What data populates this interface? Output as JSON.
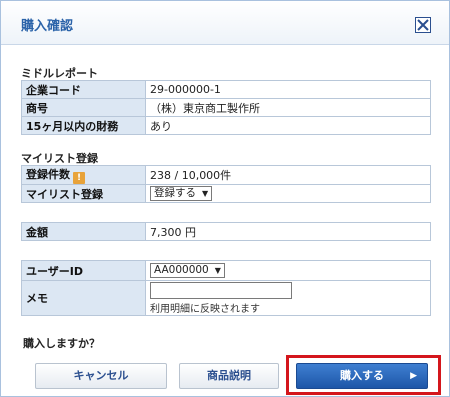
{
  "dialog": {
    "title": "購入確認",
    "close_icon": "close-x-icon"
  },
  "report": {
    "section_title": "ミドルレポート",
    "rows": [
      {
        "label": "企業コード",
        "value": "29-000000-1"
      },
      {
        "label": "商号",
        "value": "（株）東京商工製作所"
      },
      {
        "label": "15ヶ月以内の財務",
        "value": "あり"
      }
    ]
  },
  "mylist": {
    "section_title": "マイリスト登録",
    "count_label": "登録件数",
    "count_icon": "warning-icon",
    "count_icon_glyph": "!",
    "count_value": "238 / 10,000件",
    "register_label": "マイリスト登録",
    "register_selected": "登録する"
  },
  "amount": {
    "label": "金額",
    "value": "7,300 円"
  },
  "user": {
    "id_label": "ユーザーID",
    "id_selected": "AA000000",
    "memo_label": "メモ",
    "memo_value": "",
    "memo_note": "利用明細に反映されます"
  },
  "question": "購入しますか？",
  "buttons": {
    "cancel": "キャンセル",
    "description": "商品説明",
    "purchase": "購入する"
  },
  "colors": {
    "title": "#2b63a9",
    "label_bg": "#dce7f3",
    "highlight": "#d4161c",
    "primary_button": "#1d56a8"
  }
}
